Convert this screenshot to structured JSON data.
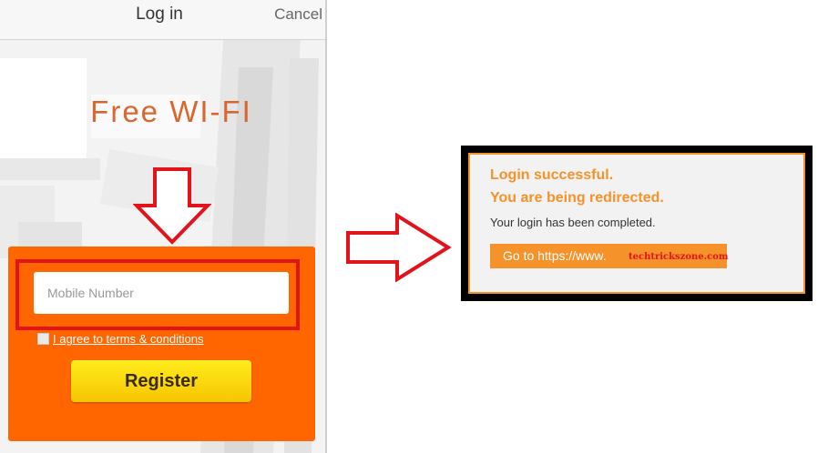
{
  "login_screen": {
    "title": "Log in",
    "cancel_label": "Cancel",
    "hero_text": "Free WI-FI",
    "mobile_placeholder": "Mobile Number",
    "mobile_value": "",
    "terms_label": "I agree to terms & conditions",
    "terms_checked": false,
    "register_label": "Register"
  },
  "success_screen": {
    "title": "Login successful.",
    "subtitle": "You are being redirected.",
    "message": "Your login has been completed.",
    "goto_label": "Go to https://www.",
    "domain_overlay": "techtrickszone.com"
  },
  "colors": {
    "orange_card": "#ff6600",
    "accent_orange": "#f5922a",
    "highlight_red": "#e1141c",
    "register_yellow": "#f6c503"
  },
  "icons": [
    "down-arrow-icon",
    "right-arrow-icon"
  ]
}
